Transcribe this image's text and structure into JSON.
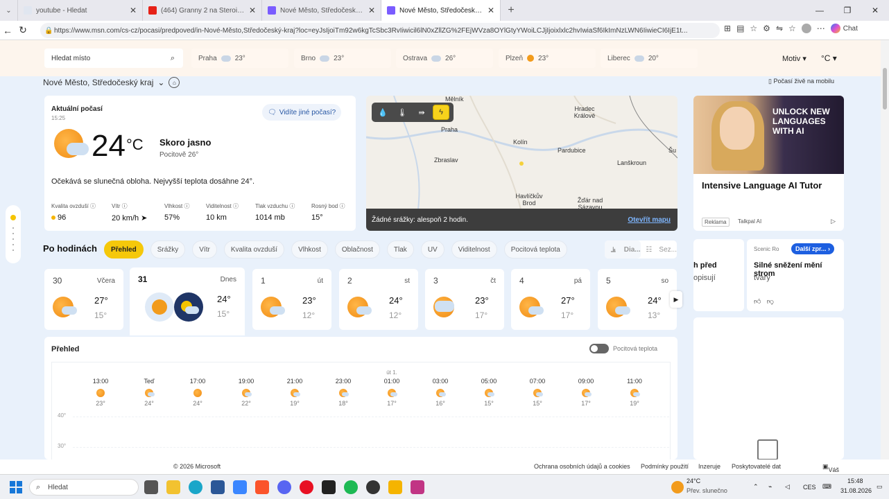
{
  "browser": {
    "tabs": [
      {
        "title": "youtube - Hledat",
        "color": "#4285f4"
      },
      {
        "title": "(464) Granny 2 na Steroidech",
        "color": "#e62117"
      },
      {
        "title": "Nové Město, Středočeský kraj – př",
        "color": "#7a5cff"
      },
      {
        "title": "Nové Město, Středočeský kraj – př",
        "color": "#7a5cff"
      }
    ],
    "url": "https://www.msn.com/cs-cz/pocasi/predpoved/in-Nové-Město,Středočeský-kraj?loc=eyJsIjoiTm92w6kgTcSbc3RvIiwicil6lN0xZllZG%2FEjWVza8OYlGtyYWoiLCJjIjoixlxlc2hvIwiaSf6IkImNzLWN6IiwieCI6IjE1t...",
    "copilot_label": "Chat"
  },
  "header": {
    "search_placeholder": "Hledat místo",
    "cities": [
      {
        "name": "Praha",
        "temp": "23°",
        "icon": "cloud-icon"
      },
      {
        "name": "Brno",
        "temp": "23°",
        "icon": "cloud-icon"
      },
      {
        "name": "Ostrava",
        "temp": "26°",
        "icon": "cloud-icon"
      },
      {
        "name": "Plzeň",
        "temp": "23°",
        "icon": "sun-icon"
      },
      {
        "name": "Liberec",
        "temp": "20°",
        "icon": "cloud-icon"
      }
    ],
    "motiv": "Motiv ▾",
    "unit": "°C ▾"
  },
  "location": "Nové Město, Středočeský kraj",
  "mobile_link": "Počasí živě na mobilu",
  "current": {
    "label": "Aktuální počasí",
    "time": "15:25",
    "see_other": "Vidíte jiné počasí?",
    "temp": "24",
    "unit": "°C",
    "condition": "Skoro jasno",
    "feels": "Pocitově 26°",
    "description": "Očekává se slunečná obloha. Nejvyšší teplota dosáhne 24°.",
    "stats": [
      {
        "key": "Kvalita ovzduší ⓘ",
        "value": "96"
      },
      {
        "key": "Vítr ⓘ",
        "value": "20 km/h ➤"
      },
      {
        "key": "Vlhkost ⓘ",
        "value": "57%"
      },
      {
        "key": "Viditelnost ⓘ",
        "value": "10 km"
      },
      {
        "key": "Tlak vzduchu ⓘ",
        "value": "1014 mb"
      },
      {
        "key": "Rosný bod ⓘ",
        "value": "15°"
      }
    ]
  },
  "map": {
    "labels": [
      "Mělník",
      "Hradec Králové",
      "Praha",
      "Kolín",
      "Pardubice",
      "Zbraslav",
      "Lanškroun",
      "Havlíčkův Brod",
      "Žďár nad Sázavou",
      "Šu"
    ],
    "status": "Žádné srážky: alespoň 2 hodin.",
    "open_link": "Otevřít mapu"
  },
  "ad": {
    "image_text": "UNLOCK NEW LANGUAGES WITH AI",
    "title": "Intensive Language AI Tutor",
    "badge": "Reklama",
    "sponsor": "Talkpal AI"
  },
  "news": [
    {
      "title": "h před",
      "sub": "opisují"
    },
    {
      "source": "Scenic Ro",
      "next": "Další zpr... ›",
      "title": "Silné sněžení mění strom",
      "sub": "tvary"
    }
  ],
  "hourly_title": "Po hodinách",
  "pills": [
    "Přehled",
    "Srážky",
    "Vítr",
    "Kvalita ovzduší",
    "Vlhkost",
    "Oblačnost",
    "Tlak",
    "UV",
    "Viditelnost",
    "Pocitová teplota"
  ],
  "view_switch": [
    "Dia...",
    "Sez..."
  ],
  "days": [
    {
      "num": "30",
      "name": "Včera",
      "hi": "27°",
      "lo": "15°"
    },
    {
      "num": "31",
      "name": "Dnes",
      "hi": "24°",
      "lo": "15°"
    },
    {
      "num": "1",
      "name": "út",
      "hi": "23°",
      "lo": "12°"
    },
    {
      "num": "2",
      "name": "st",
      "hi": "24°",
      "lo": "12°"
    },
    {
      "num": "3",
      "name": "čt",
      "hi": "23°",
      "lo": "17°"
    },
    {
      "num": "4",
      "name": "pá",
      "hi": "27°",
      "lo": "17°"
    },
    {
      "num": "5",
      "name": "so",
      "hi": "24°",
      "lo": "13°"
    }
  ],
  "overview": {
    "title": "Přehled",
    "toggle_label": "Pocitová teplota",
    "hours": [
      {
        "day": "",
        "time": "13:00",
        "temp": "23°",
        "cloudy": false
      },
      {
        "day": "",
        "time": "Teď",
        "temp": "24°",
        "cloudy": true
      },
      {
        "day": "",
        "time": "17:00",
        "temp": "24°",
        "cloudy": false
      },
      {
        "day": "",
        "time": "19:00",
        "temp": "22°",
        "cloudy": true
      },
      {
        "day": "",
        "time": "21:00",
        "temp": "19°",
        "cloudy": true
      },
      {
        "day": "",
        "time": "23:00",
        "temp": "18°",
        "cloudy": true
      },
      {
        "day": "út 1.",
        "time": "01:00",
        "temp": "17°",
        "cloudy": true
      },
      {
        "day": "",
        "time": "03:00",
        "temp": "16°",
        "cloudy": true
      },
      {
        "day": "",
        "time": "05:00",
        "temp": "15°",
        "cloudy": true
      },
      {
        "day": "",
        "time": "07:00",
        "temp": "15°",
        "cloudy": true
      },
      {
        "day": "",
        "time": "09:00",
        "temp": "17°",
        "cloudy": true
      },
      {
        "day": "",
        "time": "11:00",
        "temp": "19°",
        "cloudy": true
      }
    ],
    "yaxis": [
      "40°",
      "30°"
    ]
  },
  "footer": {
    "copyright": "© 2026 Microsoft",
    "links": [
      "Ochrana osobních údajů a cookies",
      "Podmínky použití",
      "Inzeruje",
      "Poskytovatelé dat"
    ],
    "feedback": "Váš názor"
  },
  "taskbar": {
    "search": "Hledat",
    "weather_temp": "24°C",
    "weather_desc": "Přev. slunečno",
    "lang": "CES",
    "time": "15:48",
    "date": "31.08.2026"
  }
}
